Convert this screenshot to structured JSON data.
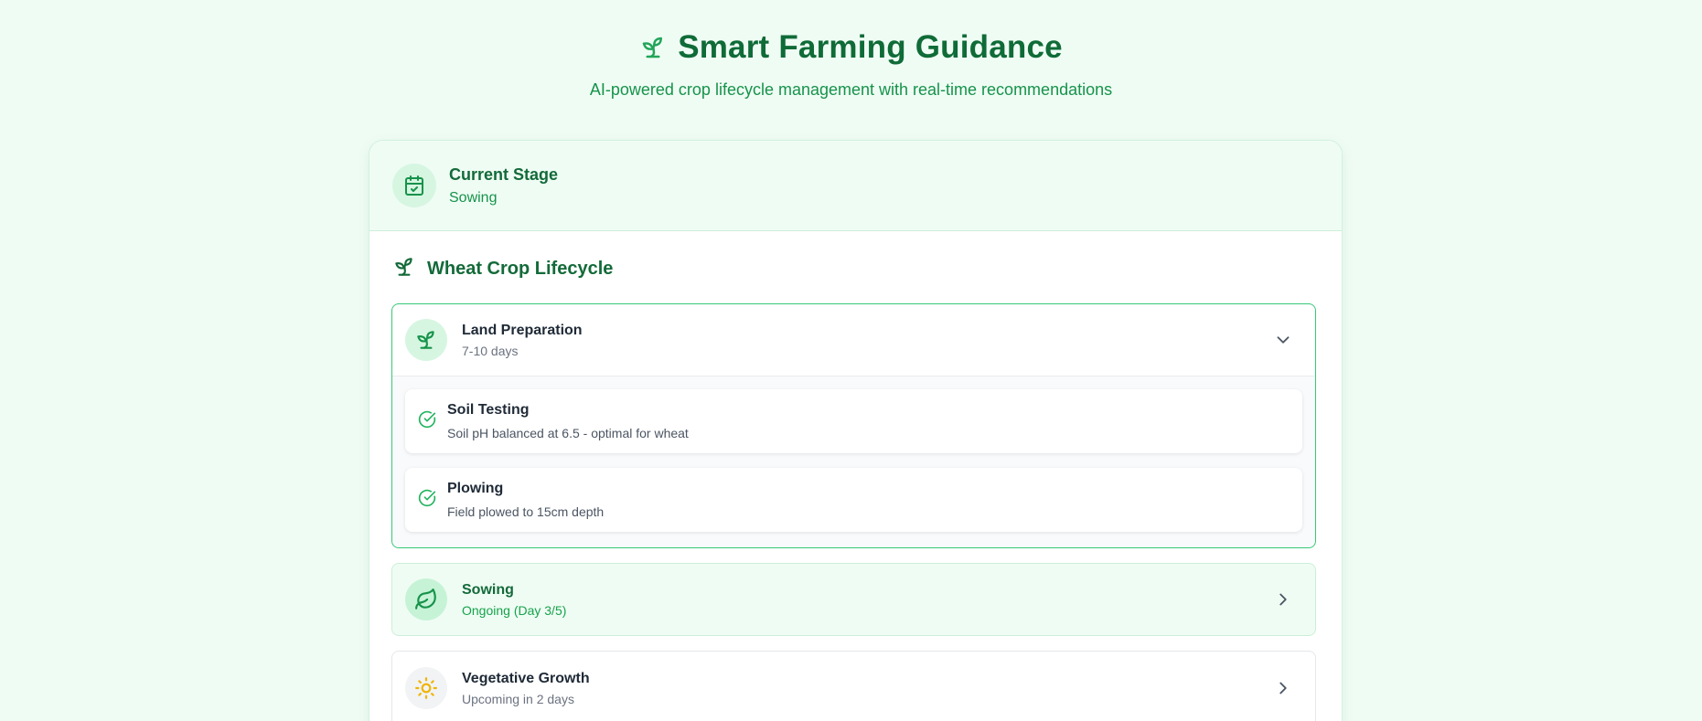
{
  "header": {
    "title": "Smart Farming Guidance",
    "subtitle": "AI-powered crop lifecycle management with real-time recommendations",
    "icon": "sprout-icon"
  },
  "current_stage": {
    "label": "Current Stage",
    "value": "Sowing",
    "icon": "calendar-check-icon"
  },
  "lifecycle": {
    "title": "Wheat Crop Lifecycle",
    "icon": "sprout-icon",
    "stages": [
      {
        "name": "Land Preparation",
        "subtitle": "7-10 days",
        "icon": "sprout-icon",
        "expanded": true,
        "tasks": [
          {
            "name": "Soil Testing",
            "description": "Soil pH balanced at 6.5 - optimal for wheat",
            "icon": "check-circle-icon"
          },
          {
            "name": "Plowing",
            "description": "Field plowed to 15cm depth",
            "icon": "check-circle-icon"
          }
        ]
      },
      {
        "name": "Sowing",
        "subtitle": "Ongoing (Day 3/5)",
        "icon": "leaf-icon",
        "expanded": false
      },
      {
        "name": "Vegetative Growth",
        "subtitle": "Upcoming in 2 days",
        "icon": "sun-icon",
        "expanded": false
      }
    ]
  },
  "colors": {
    "background": "#effcf4",
    "primary_dark": "#0f6b37",
    "primary": "#16934a",
    "accent_border": "#38c779",
    "sun": "#f0b400"
  }
}
